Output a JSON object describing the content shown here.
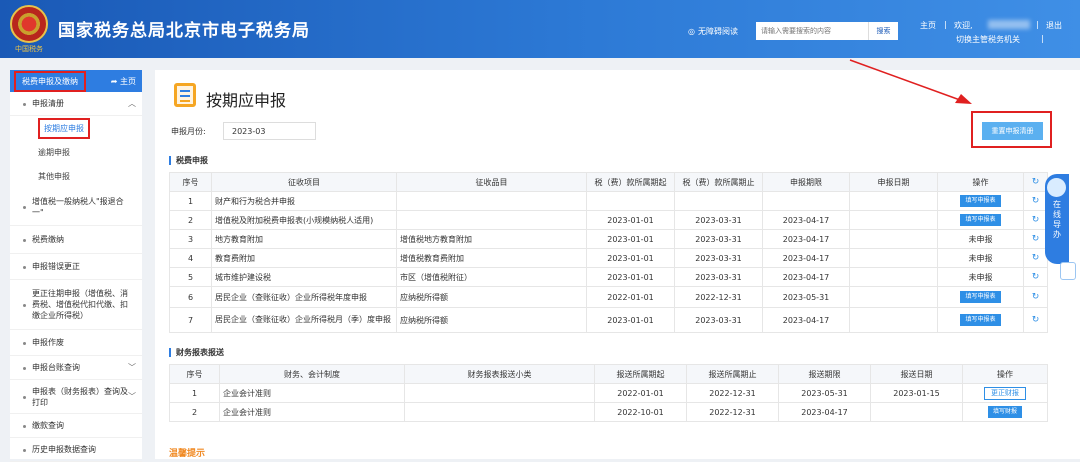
{
  "header": {
    "emblem_text": "中国税务",
    "title": "国家税务总局北京市电子税务局",
    "accessibility": "无障碍阅读",
    "search_placeholder": "请输入需要搜索的内容",
    "search_btn": "搜索",
    "home": "主页",
    "welcome": "欢迎,",
    "switch": "切换主管税务机关",
    "logout": "退出",
    "sep1": "|",
    "sep2": "|",
    "sep3": "|",
    "sep4": "|"
  },
  "sidebar": {
    "head_label": "税费申报及缴纳",
    "home_link": "主页",
    "items": [
      "申报清册",
      "增值税一般纳税人\"报退合一\"",
      "税费缴纳",
      "申报错误更正",
      "更正往期申报（增值税、消费税、增值税代扣代缴、扣缴企业所得税）",
      "申报作废",
      "申报台账查询",
      "申报表（财务报表）查询及打印",
      "缴款查询",
      "历史申报数据查询"
    ],
    "subs": [
      "按期应申报",
      "逾期申报",
      "其他申报"
    ]
  },
  "main": {
    "title": "按期应申报",
    "month_label": "申报月份:",
    "month_value": "2023-03",
    "reset_btn": "重置申报清册",
    "tax_section": "税费申报",
    "fin_section": "财务报表报送",
    "tip": "温馨提示"
  },
  "tax_table": {
    "headers": [
      "序号",
      "征收项目",
      "征收品目",
      "税（费）款所属期起",
      "税（费）款所属期止",
      "申报期限",
      "申报日期",
      "操作"
    ],
    "rows": [
      [
        "1",
        "财产和行为税合并申报",
        "",
        "",
        "",
        "",
        "",
        "填写申报表"
      ],
      [
        "2",
        "增值税及附加税费申报表(小规模纳税人适用)",
        "",
        "2023-01-01",
        "2023-03-31",
        "2023-04-17",
        "",
        "填写申报表"
      ],
      [
        "3",
        "地方教育附加",
        "增值税地方教育附加",
        "2023-01-01",
        "2023-03-31",
        "2023-04-17",
        "",
        "未申报"
      ],
      [
        "4",
        "教育费附加",
        "增值税教育费附加",
        "2023-01-01",
        "2023-03-31",
        "2023-04-17",
        "",
        "未申报"
      ],
      [
        "5",
        "城市维护建设税",
        "市区（增值税附征）",
        "2023-01-01",
        "2023-03-31",
        "2023-04-17",
        "",
        "未申报"
      ],
      [
        "6",
        "居民企业（查账征收）企业所得税年度申报",
        "应纳税所得额",
        "2022-01-01",
        "2022-12-31",
        "2023-05-31",
        "",
        "填写申报表"
      ],
      [
        "7",
        "居民企业（查账征收）企业所得税月（季）度申报",
        "应纳税所得额",
        "2023-01-01",
        "2023-03-31",
        "2023-04-17",
        "",
        "填写申报表"
      ]
    ]
  },
  "fin_table": {
    "headers": [
      "序号",
      "财务、会计制度",
      "财务报表报送小类",
      "报送所属期起",
      "报送所属期止",
      "报送期限",
      "报送日期",
      "操作"
    ],
    "rows": [
      [
        "1",
        "企业会计准则",
        "",
        "2022-01-01",
        "2022-12-31",
        "2023-05-31",
        "2023-01-15",
        "更正财报"
      ],
      [
        "2",
        "企业会计准则",
        "",
        "2022-10-01",
        "2022-12-31",
        "2023-04-17",
        "",
        "填写财报"
      ]
    ]
  },
  "float_panel": {
    "text": "在线导办"
  },
  "colors": {
    "header_blue": "#1a59b6",
    "accent_blue": "#2e7de1",
    "highlight_red": "#e02020",
    "tip_orange": "#f08a24"
  }
}
